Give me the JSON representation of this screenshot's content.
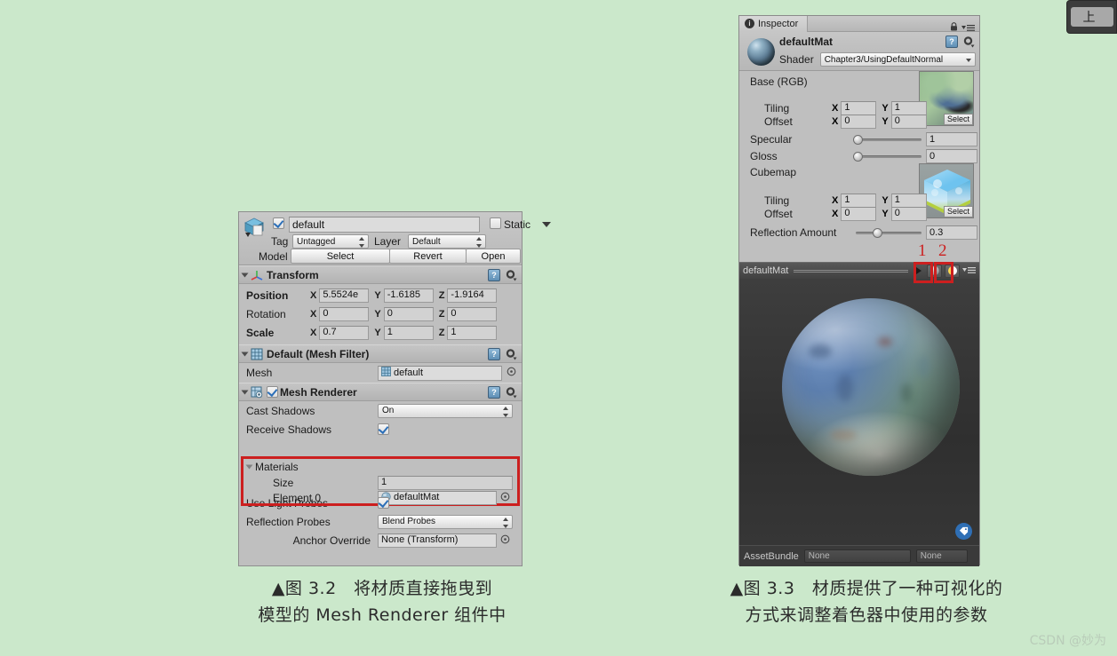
{
  "background_color": "#cbe8cb",
  "accent_red": "#cc1f1f",
  "top_fragment": {
    "label": "上"
  },
  "left_panel": {
    "name": "inspector-game-object",
    "object_name_value": "default",
    "active_checkbox": true,
    "static_label": "Static",
    "static_checked": false,
    "tag_label": "Tag",
    "tag_value": "Untagged",
    "layer_label": "Layer",
    "layer_value": "Default",
    "model_label": "Model",
    "model_buttons": [
      "Select",
      "Revert",
      "Open"
    ],
    "transform": {
      "title": "Transform",
      "rows": [
        {
          "label": "Position",
          "x": "5.5524e",
          "y": "-1.6185",
          "z": "-1.9164"
        },
        {
          "label": "Rotation",
          "x": "0",
          "y": "0",
          "z": "0"
        },
        {
          "label": "Scale",
          "x": "0.7",
          "y": "1",
          "z": "1"
        }
      ],
      "axis_labels": [
        "X",
        "Y",
        "Z"
      ]
    },
    "mesh_filter": {
      "title": "Default (Mesh Filter)",
      "mesh_label": "Mesh",
      "mesh_value": "default"
    },
    "mesh_renderer": {
      "title": "Mesh Renderer",
      "enabled": true,
      "cast_shadows_label": "Cast Shadows",
      "cast_shadows_value": "On",
      "receive_shadows_label": "Receive Shadows",
      "receive_shadows_checked": true,
      "materials_label": "Materials",
      "size_label": "Size",
      "size_value": "1",
      "element0_label": "Element 0",
      "element0_value": "defaultMat",
      "use_light_probes_label": "Use Light Probes",
      "use_light_probes_checked": true,
      "reflection_probes_label": "Reflection Probes",
      "reflection_probes_value": "Blend Probes",
      "anchor_override_label": "Anchor Override",
      "anchor_override_value": "None (Transform)"
    }
  },
  "right_panel": {
    "tab_label": "Inspector",
    "material_name": "defaultMat",
    "shader_label": "Shader",
    "shader_value": "Chapter3/UsingDefaultNormal",
    "properties": {
      "base_label": "Base (RGB)",
      "base_tiling_label": "Tiling",
      "base_offset_label": "Offset",
      "base_tiling": {
        "x": "1",
        "y": "1"
      },
      "base_offset": {
        "x": "0",
        "y": "0"
      },
      "base_select_label": "Select",
      "specular_label": "Specular",
      "specular_value": "1",
      "specular_slider_pct": 2,
      "gloss_label": "Gloss",
      "gloss_value": "0",
      "gloss_slider_pct": 2,
      "cubemap_label": "Cubemap",
      "cubemap_tiling_label": "Tiling",
      "cubemap_offset_label": "Offset",
      "cubemap_tiling": {
        "x": "1",
        "y": "1"
      },
      "cubemap_offset": {
        "x": "0",
        "y": "0"
      },
      "cubemap_select_label": "Select",
      "reflection_amount_label": "Reflection Amount",
      "reflection_amount_value": "0.3",
      "reflection_amount_slider_pct": 30,
      "axis_x": "X",
      "axis_y": "Y"
    },
    "preview": {
      "name_label": "defaultMat",
      "annotation_1": "1",
      "annotation_2": "2",
      "icon_1_name": "preview-shape-sphere",
      "icon_2_name": "preview-lighting-toggle"
    },
    "assetbundle": {
      "label": "AssetBundle",
      "bundle_value": "None",
      "variant_value": "None"
    }
  },
  "caption_left": {
    "line1": "▲图 3.2　将材质直接拖曳到",
    "line2": "模型的 Mesh Renderer 组件中"
  },
  "caption_right": {
    "line1": "▲图 3.3　材质提供了一种可视化的",
    "line2": "方式来调整着色器中使用的参数"
  },
  "watermark": "CSDN @妙为"
}
